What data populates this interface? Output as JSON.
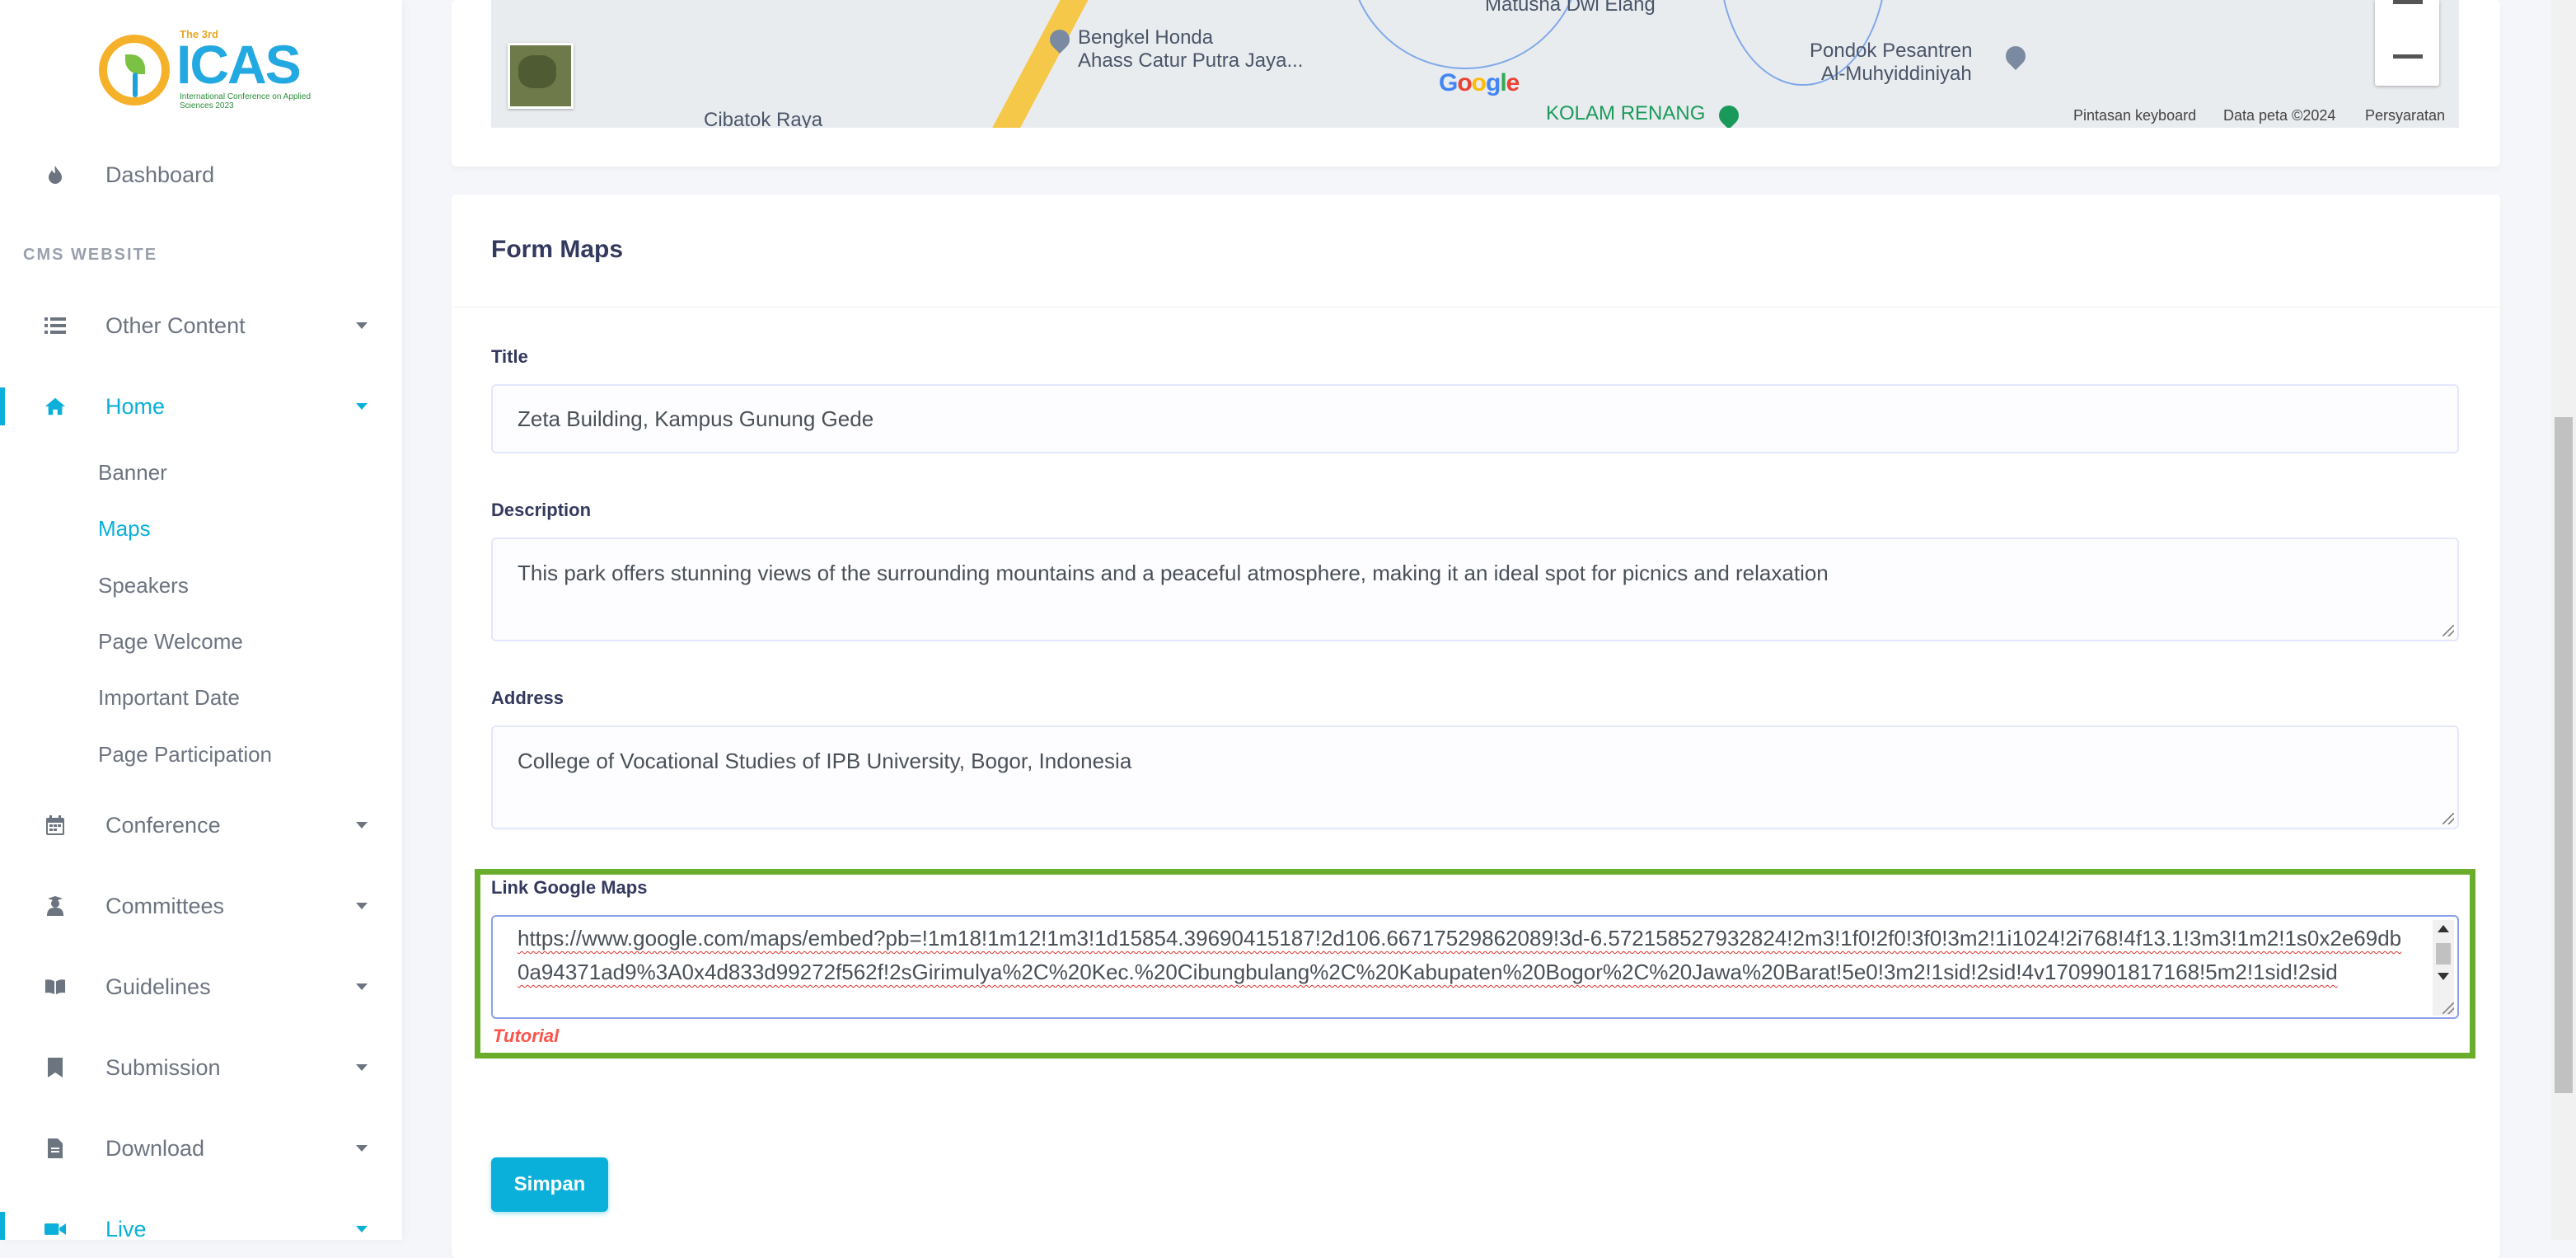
{
  "sidebar": {
    "logo": {
      "small": "The 3rd",
      "main": "ICAS",
      "sub": "International Conference on Applied Sciences 2023"
    },
    "dashboard": "Dashboard",
    "section_header": "CMS WEBSITE",
    "other_content": "Other Content",
    "home": "Home",
    "home_sub": [
      "Banner",
      "Maps",
      "Speakers",
      "Page Welcome",
      "Important Date",
      "Page Participation"
    ],
    "conference": "Conference",
    "committees": "Committees",
    "guidelines": "Guidelines",
    "submission": "Submission",
    "download": "Download",
    "live": "Live"
  },
  "map": {
    "labels": {
      "bengkel1": "Bengkel Honda",
      "bengkel2": "Ahass Catur Putra Jaya...",
      "matusha": "Matusha Dwi Elang",
      "pondok1": "Pondok Pesantren",
      "pondok2": "Al-Muhyiddiniyah",
      "cibatok": "Cibatok Raya",
      "kolam": "KOLAM RENANG",
      "google": "Google"
    },
    "footer": {
      "keyboard": "Pintasan keyboard",
      "data": "Data peta ©2024",
      "terms": "Persyaratan"
    }
  },
  "form": {
    "heading": "Form Maps",
    "title_label": "Title",
    "title_value": "Zeta Building, Kampus Gunung Gede",
    "description_label": "Description",
    "description_value": "This park offers stunning views of the surrounding mountains and a peaceful atmosphere, making it an ideal spot for picnics and relaxation",
    "address_label": "Address",
    "address_value": "College of Vocational Studies of IPB University, Bogor, Indonesia",
    "link_label": "Link Google Maps",
    "link_value": "https://www.google.com/maps/embed?pb=!1m18!1m12!1m3!1d15854.39690415187!2d106.66717529862089!3d-6.572158527932824!2m3!1f0!2f0!3f0!3m2!1i1024!2i768!4f13.1!3m3!1m2!1s0x2e69db0a94371ad9%3A0x4d833d99272f562f!2sGirimulya%2C%20Kec.%20Cibungbulang%2C%20Kabupaten%20Bogor%2C%20Jawa%20Barat!5e0!3m2!1sid!2sid!4v1709901817168!5m2!1sid!2sid",
    "tutorial": "Tutorial",
    "submit": "Simpan"
  }
}
